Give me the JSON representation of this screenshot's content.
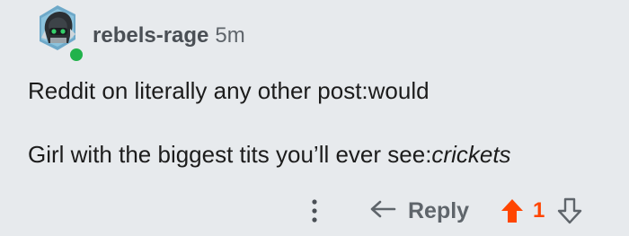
{
  "comment": {
    "username": "rebels-rage",
    "timestamp": "5m",
    "body_line1": "Reddit on literally any other post:would",
    "body_line2_prefix": "Girl with the biggest tits you’ll ever see:",
    "body_line2_italic": "crickets"
  },
  "actions": {
    "more_icon": "vertical-ellipsis",
    "reply_icon": "reply-arrow",
    "reply_label": "Reply",
    "upvote_icon": "upvote-arrow-filled",
    "vote_count": "1",
    "downvote_icon": "downvote-arrow-outline"
  },
  "colors": {
    "background": "#e7eaed",
    "upvote_active": "#ff4500",
    "online_status": "#21b24b",
    "muted_text": "#5f656b"
  }
}
